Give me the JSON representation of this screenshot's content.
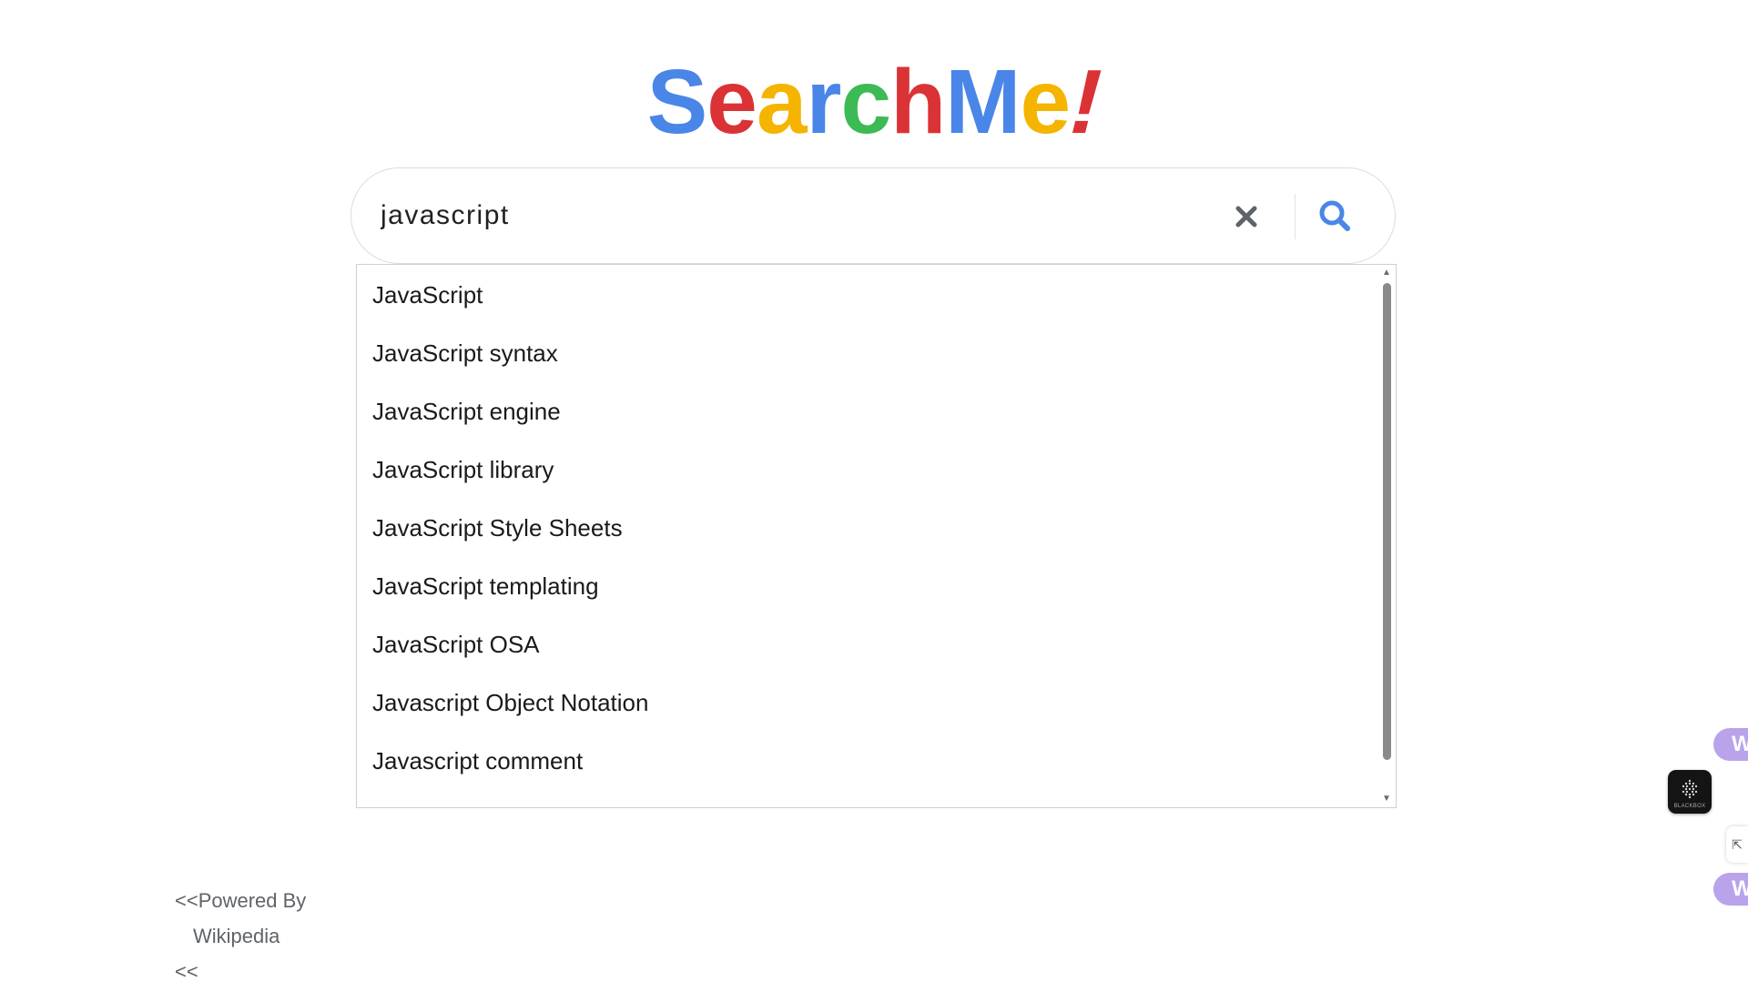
{
  "logo": {
    "letters": [
      {
        "char": "S",
        "color": "#4a86e8"
      },
      {
        "char": "e",
        "color": "#db3236"
      },
      {
        "char": "a",
        "color": "#f4b400"
      },
      {
        "char": "r",
        "color": "#4a86e8"
      },
      {
        "char": "c",
        "color": "#3cba54"
      },
      {
        "char": "h",
        "color": "#db3236"
      },
      {
        "char": "M",
        "color": "#4a86e8"
      },
      {
        "char": "e",
        "color": "#f4b400"
      }
    ],
    "bang": "!",
    "bang_color": "#db3236"
  },
  "search": {
    "value": "javascript",
    "clear_icon": "close-icon",
    "search_icon": "search-icon",
    "search_icon_color": "#4a86e8",
    "clear_icon_color": "#5f6368"
  },
  "suggestions": {
    "items": [
      "JavaScript",
      "JavaScript syntax",
      "JavaScript engine",
      "JavaScript library",
      "JavaScript Style Sheets",
      "JavaScript templating",
      "JavaScript OSA",
      "Javascript Object Notation",
      "Javascript comment"
    ]
  },
  "footer": {
    "powered_line1": "<<Powered By",
    "powered_line2": "Wikipedia",
    "powered_line3": "<<"
  },
  "widgets": {
    "w_label": "W",
    "blackbox_label": "BLACKBOX",
    "edge_tab_glyph": "⇱"
  }
}
